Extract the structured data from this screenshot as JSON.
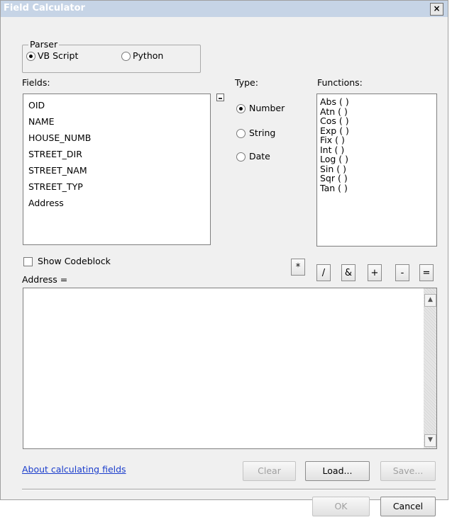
{
  "window": {
    "title": "Field Calculator",
    "close_glyph": "×"
  },
  "parser": {
    "legend": "Parser",
    "options": [
      "VB Script",
      "Python"
    ],
    "selected": "VB Script"
  },
  "fields": {
    "label": "Fields:",
    "items": [
      "OID",
      "NAME",
      "HOUSE_NUMB",
      "STREET_DIR",
      "STREET_NAM",
      "STREET_TYP",
      "Address"
    ]
  },
  "type": {
    "label": "Type:",
    "options": [
      "Number",
      "String",
      "Date"
    ],
    "selected": "Number"
  },
  "functions": {
    "label": "Functions:",
    "items": [
      "Abs ( )",
      "Atn ( )",
      "Cos ( )",
      "Exp ( )",
      "Fix ( )",
      "Int ( )",
      "Log ( )",
      "Sin ( )",
      "Sqr ( )",
      "Tan ( )"
    ]
  },
  "codeblock": {
    "label": "Show Codeblock",
    "checked": false
  },
  "operators": [
    "*",
    "/",
    "&",
    "+",
    "-",
    "="
  ],
  "expression": {
    "label": "Address =",
    "value": ""
  },
  "scroll": {
    "up_glyph": "▲",
    "down_glyph": "▼"
  },
  "buttons": {
    "about_link": "About calculating fields",
    "clear": "Clear",
    "load": "Load...",
    "save": "Save...",
    "ok": "OK",
    "cancel": "Cancel"
  },
  "icons": {
    "close": "close-icon",
    "resize": "resize-grip-icon",
    "scroll_up": "scroll-up-arrow-icon",
    "scroll_down": "scroll-down-arrow-icon"
  }
}
